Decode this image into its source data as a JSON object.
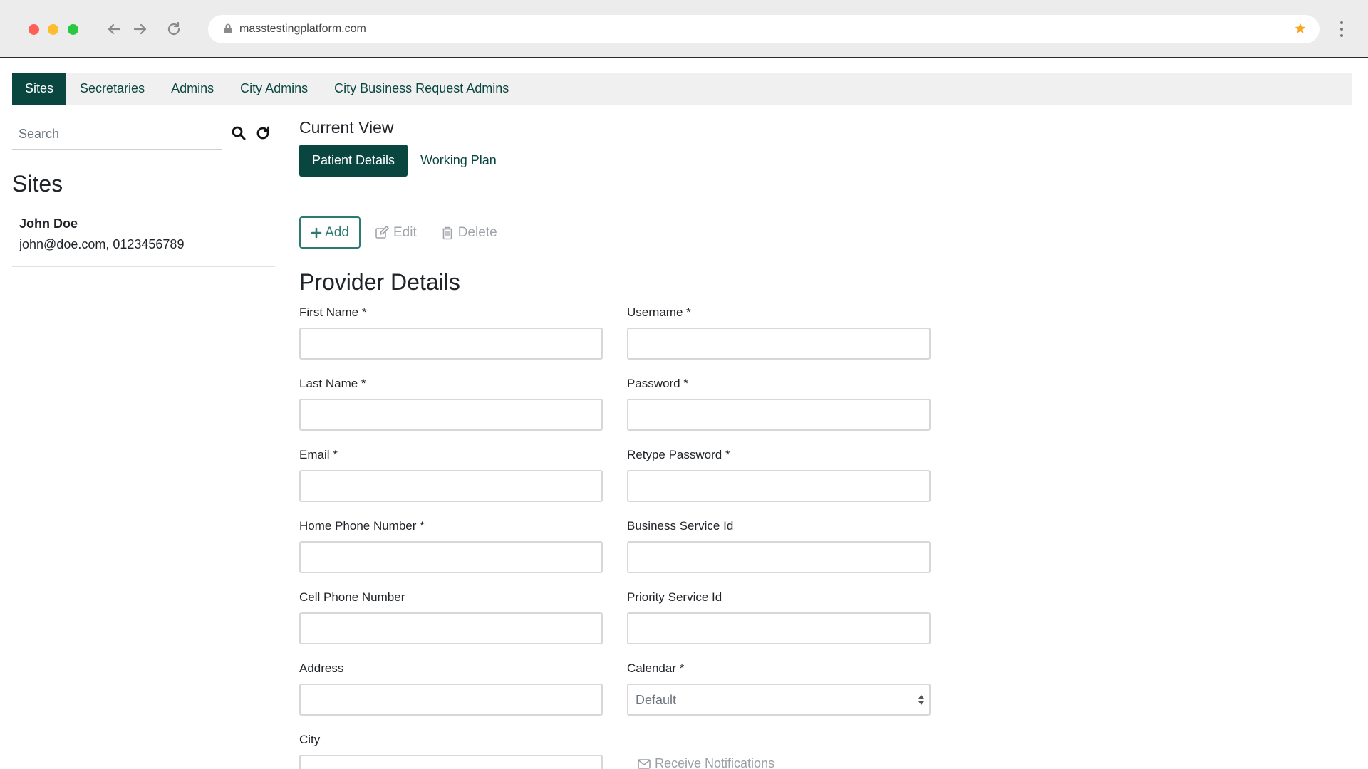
{
  "browser": {
    "url": "masstestingplatform.com"
  },
  "topnav": {
    "tabs": [
      {
        "label": "Sites"
      },
      {
        "label": "Secretaries"
      },
      {
        "label": "Admins"
      },
      {
        "label": "City Admins"
      },
      {
        "label": "City Business Request Admins"
      }
    ],
    "active_index": 0
  },
  "sidebar": {
    "search_placeholder": "Search",
    "heading": "Sites",
    "items": [
      {
        "name": "John Doe",
        "info": "john@doe.com, 0123456789"
      }
    ]
  },
  "main": {
    "current_view_label": "Current View",
    "view_tabs": [
      {
        "label": "Patient Details"
      },
      {
        "label": "Working Plan"
      }
    ],
    "actions": {
      "add": "Add",
      "edit": "Edit",
      "delete": "Delete"
    },
    "section_title": "Provider Details",
    "fields": {
      "first_name": "First Name *",
      "last_name": "Last Name *",
      "email": "Email *",
      "home_phone": "Home Phone Number *",
      "cell_phone": "Cell Phone Number",
      "address": "Address",
      "city": "City",
      "username": "Username *",
      "password": "Password *",
      "retype_password": "Retype Password *",
      "business_service_id": "Business Service Id",
      "priority_service_id": "Priority Service Id",
      "calendar": "Calendar *",
      "calendar_value": "Default",
      "receive_notifications": "Receive Notifications"
    }
  },
  "colors": {
    "brand": "#0a4640",
    "accent": "#2c7a72",
    "star": "#f5a623"
  }
}
